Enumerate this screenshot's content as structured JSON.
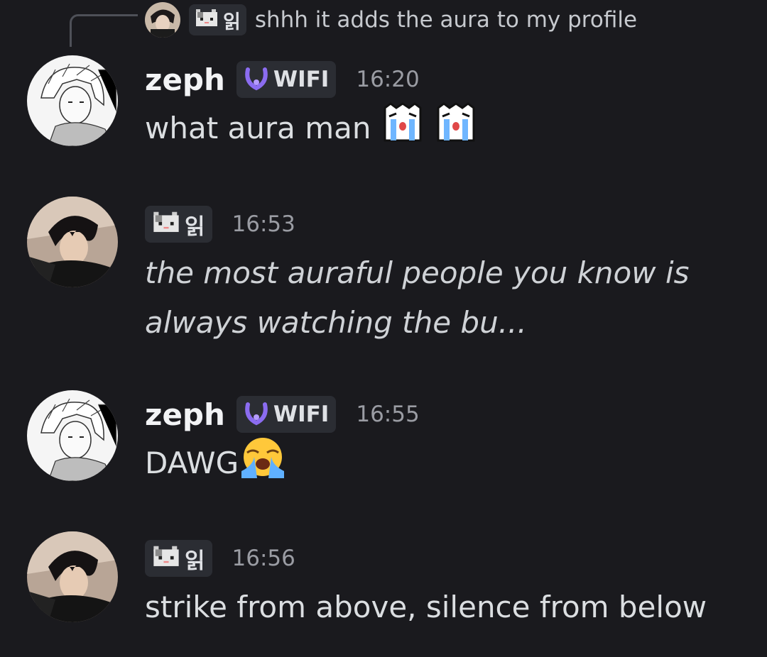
{
  "reply_preview": {
    "tag_text": "읽",
    "text": "shhh it adds the aura to my profile"
  },
  "messages": [
    {
      "author": "zeph",
      "tag": "WIFI",
      "time": "16:20",
      "text": "what aura man"
    },
    {
      "author": "",
      "tag": "읽",
      "time": "16:53",
      "text_line1": "the most auraful people you know is",
      "text_line2": "always watching the bu..."
    },
    {
      "author": "zeph",
      "tag": "WIFI",
      "time": "16:55",
      "text": "DAWG"
    },
    {
      "author": "",
      "tag": "읽",
      "time": "16:56",
      "text": "strike from above, silence from below"
    }
  ],
  "icons": {
    "cat_tag": "pixel-cat-icon",
    "wifi_tag": "purple-horseshoe-icon",
    "crying_ghost": "crying-ghost-emoji",
    "loudly_crying": "loudly-crying-face-emoji"
  },
  "colors": {
    "background": "#1a1a1e",
    "tag_background": "#2b2d33",
    "wifi_accent": "#8b6cf0",
    "timestamp": "#9a9ca3"
  }
}
